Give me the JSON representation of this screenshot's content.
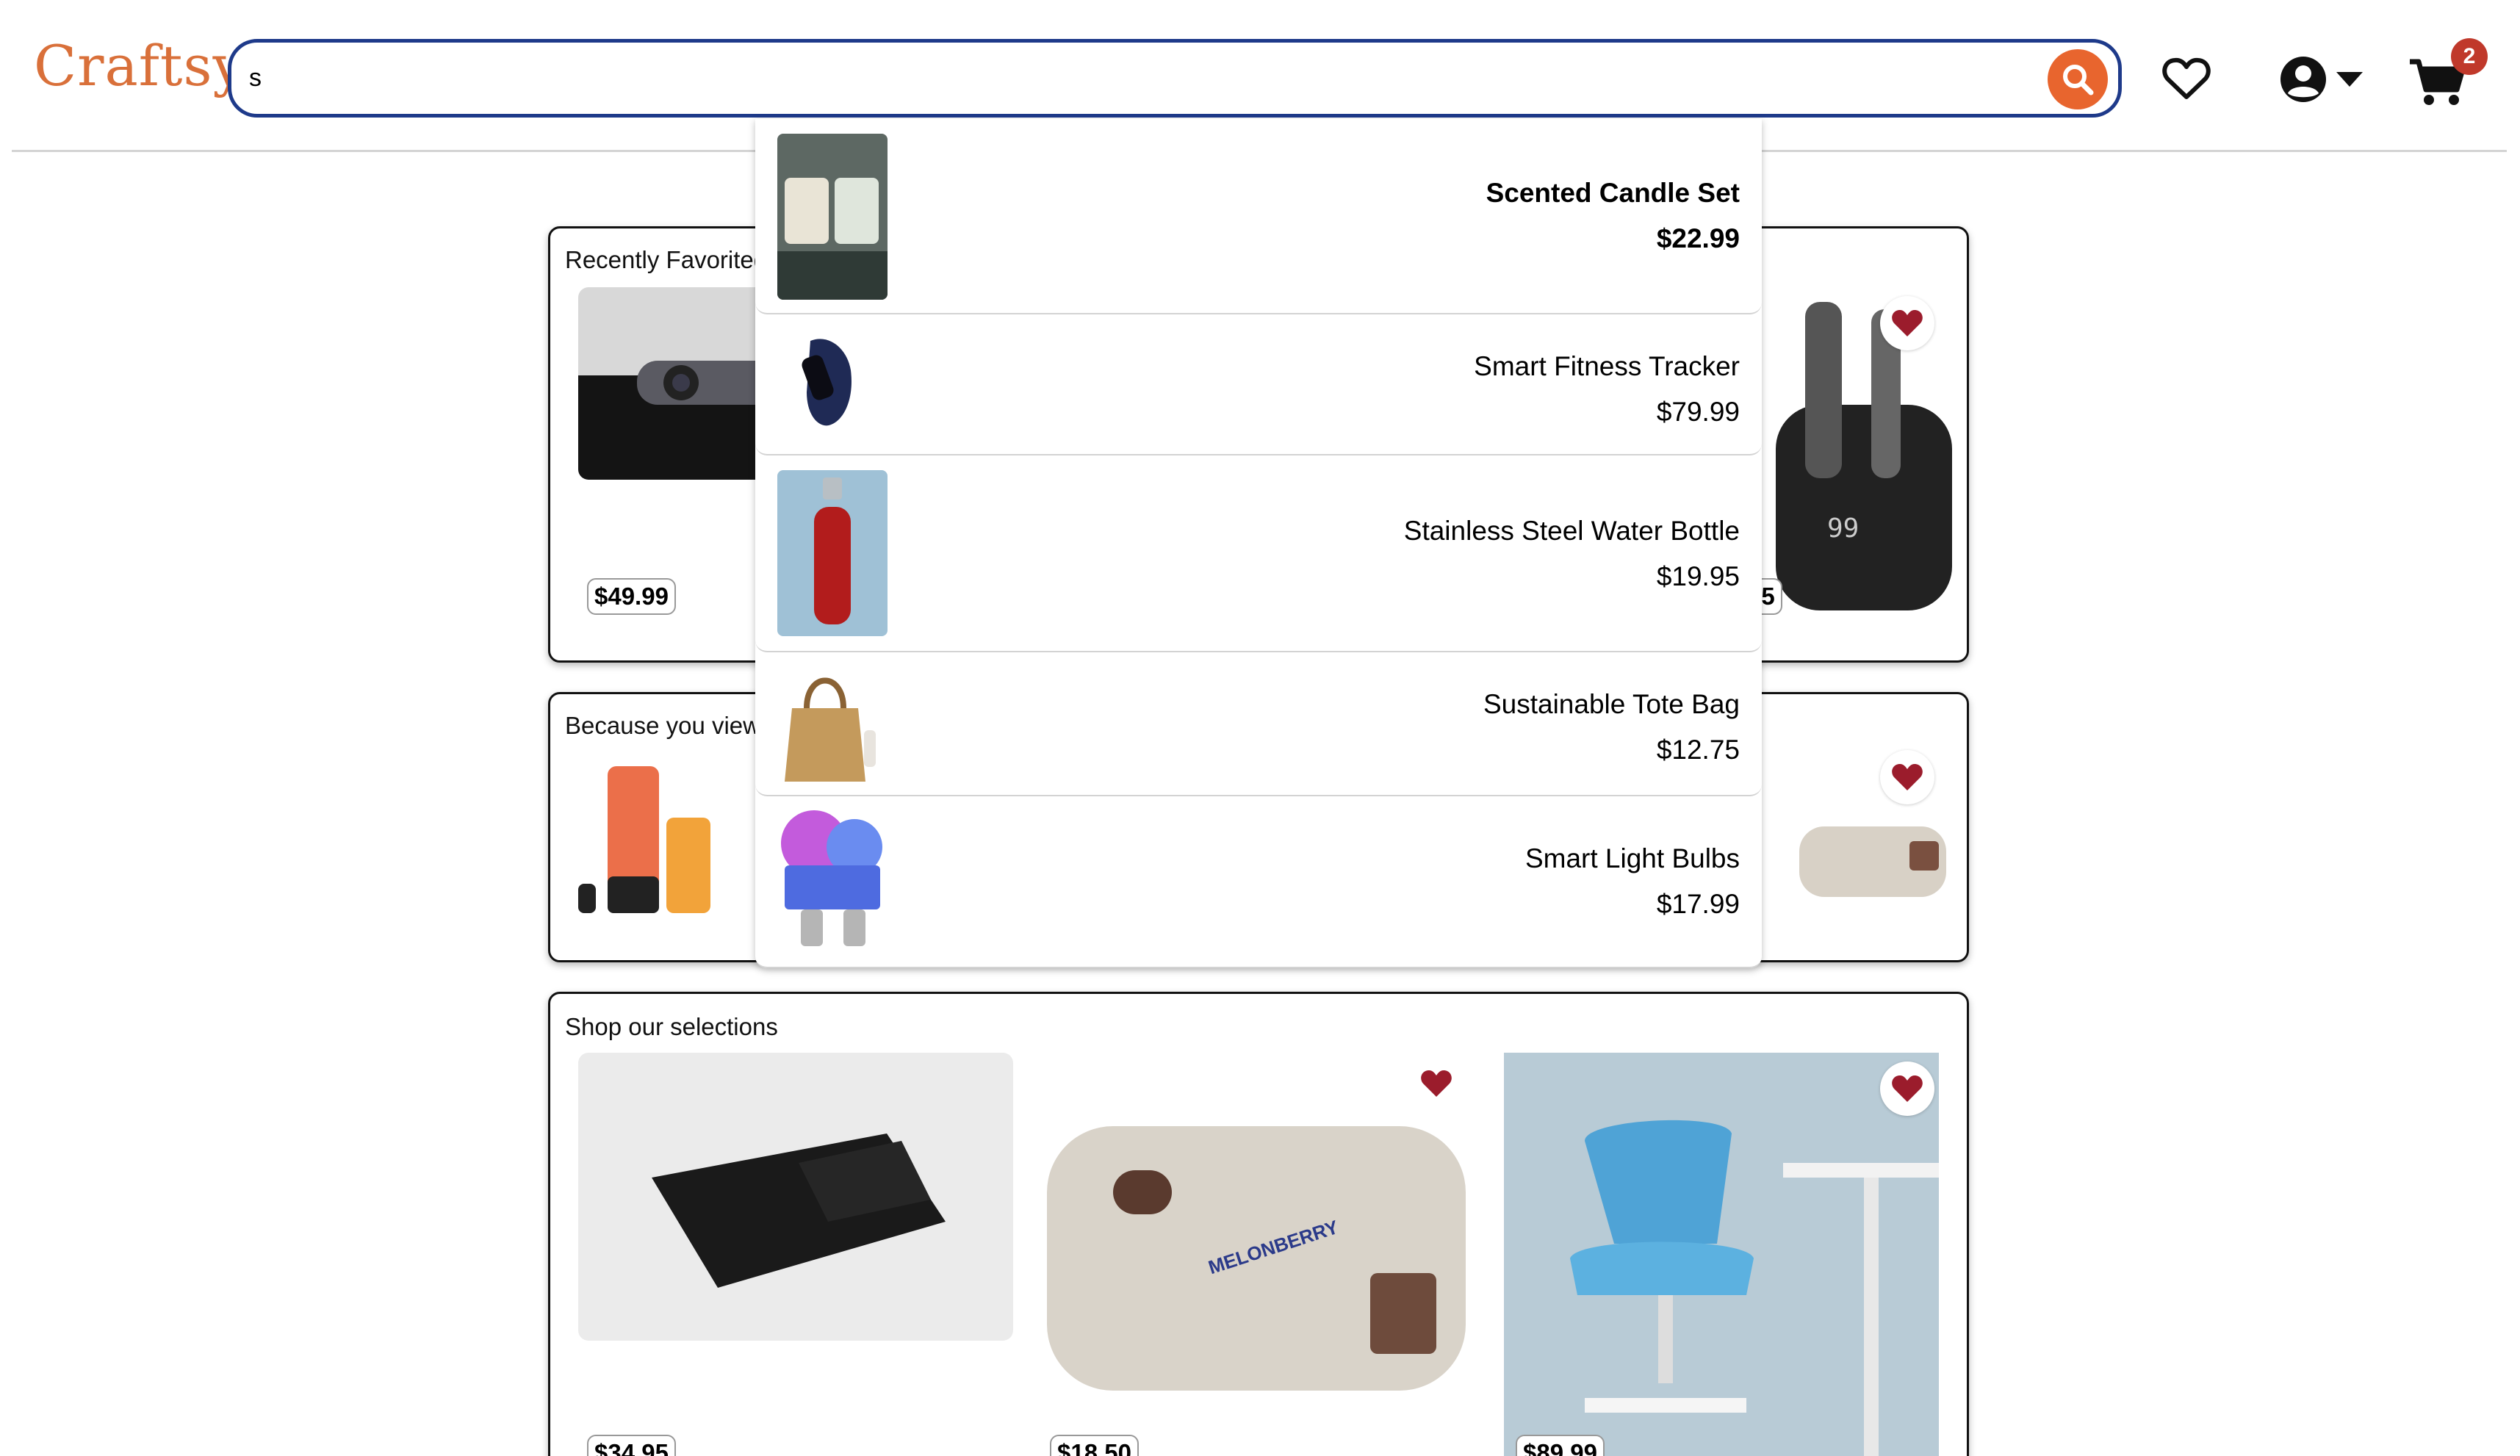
{
  "header": {
    "logo": "Craftsy",
    "search_value": "s",
    "cart_count": "2"
  },
  "suggestions": [
    {
      "name": "Scented Candle Set",
      "price": "$22.99",
      "image": "scented candle jars photo",
      "highlighted": true
    },
    {
      "name": "Smart Fitness Tracker",
      "price": "$79.99",
      "image": "fitness tracker band photo"
    },
    {
      "name": "Stainless Steel Water Bottle",
      "price": "$19.95",
      "image": "red aluminum water bottle photo"
    },
    {
      "name": "Sustainable Tote Bag",
      "price": "$12.75",
      "image": "paper tote bag photo"
    },
    {
      "name": "Smart Light Bulbs",
      "price": "$17.99",
      "image": "rgb smart bulbs photo"
    }
  ],
  "sections": {
    "recently_favorited": {
      "title": "Recently Favorited",
      "items": [
        {
          "price": "$49.99",
          "image": "webcam photo"
        },
        {
          "price": "95",
          "image": "wireless earbuds case photo",
          "favorited": true
        }
      ]
    },
    "because_viewed": {
      "title": "Because you viewe",
      "items": [
        {
          "image": "portable blender photo"
        },
        {
          "image": "bento lunch box photo",
          "favorited": true
        }
      ]
    },
    "shop_selections": {
      "title": "Shop our selections",
      "items": [
        {
          "price": "$34.95",
          "image": "leather wallet photo"
        },
        {
          "price": "$18.50",
          "image": "melonberry lunch box photo",
          "favorited": true
        },
        {
          "price": "$89.99",
          "image": "blue office chair photo",
          "favorited": true
        }
      ]
    }
  },
  "colors": {
    "brand": "#d9703a",
    "search_border": "#1e3a8a",
    "search_button": "#e8652e",
    "heart": "#9b1c2c",
    "badge": "#c0392b"
  },
  "icons": [
    "search-icon",
    "heart-outline-icon",
    "user-circle-icon",
    "caret-down-icon",
    "cart-icon",
    "heart-icon"
  ]
}
